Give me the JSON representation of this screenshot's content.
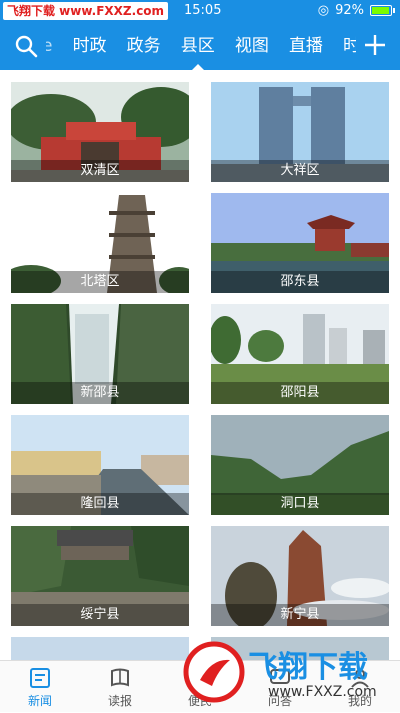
{
  "status_bar": {
    "watermark": "飞翔下载 www.FXXZ.com",
    "time": "15:05",
    "battery_percent": "92%",
    "battery_level": 0.92
  },
  "nav": {
    "partial_left": "e",
    "tabs": [
      "时政",
      "政务",
      "县区",
      "视图",
      "直播",
      "时"
    ],
    "active_tab": "县区"
  },
  "regions": [
    {
      "name": "双清区"
    },
    {
      "name": "大祥区"
    },
    {
      "name": "北塔区"
    },
    {
      "name": "邵东县"
    },
    {
      "name": "新邵县"
    },
    {
      "name": "邵阳县"
    },
    {
      "name": "隆回县"
    },
    {
      "name": "洞口县"
    },
    {
      "name": "绥宁县"
    },
    {
      "name": "新宁县"
    }
  ],
  "bottom_nav": [
    {
      "label": "新闻",
      "icon": "news-icon",
      "active": true
    },
    {
      "label": "读报",
      "icon": "newspaper-icon",
      "active": false
    },
    {
      "label": "便民",
      "icon": "service-icon",
      "active": false
    },
    {
      "label": "问答",
      "icon": "qa-icon",
      "active": false
    },
    {
      "label": "我的",
      "icon": "profile-icon",
      "active": false
    }
  ],
  "logo_watermark": {
    "brand": "飞翔下载",
    "url": "www.FXXZ.com"
  },
  "colors": {
    "primary": "#1a8fe3",
    "watermark_red": "#e02020"
  }
}
